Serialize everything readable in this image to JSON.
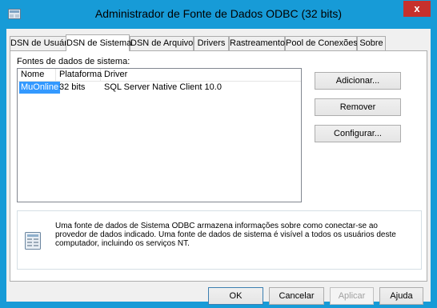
{
  "window": {
    "title": "Administrador de Fonte de Dados ODBC (32 bits)",
    "close_label": "x"
  },
  "tabs": [
    {
      "label": "DSN de Usuário"
    },
    {
      "label": "DSN de Sistema",
      "active": true
    },
    {
      "label": "DSN de Arquivo"
    },
    {
      "label": "Drivers"
    },
    {
      "label": "Rastreamento"
    },
    {
      "label": "Pool de Conexões"
    },
    {
      "label": "Sobre"
    }
  ],
  "section_label": "Fontes de dados de sistema:",
  "list": {
    "columns": [
      "Nome",
      "Plataforma",
      "Driver"
    ],
    "rows": [
      {
        "name": "MuOnline",
        "platform": "32 bits",
        "driver": "SQL Server Native Client 10.0",
        "selected": true
      }
    ]
  },
  "side_buttons": {
    "add": "Adicionar...",
    "remove": "Remover",
    "configure": "Configurar..."
  },
  "info": {
    "icon": "database-info-icon",
    "text": "Uma fonte de dados de Sistema ODBC armazena informações sobre como conectar-se ao provedor de dados indicado. Uma fonte de dados de sistema é visível a todos os usuários deste computador, incluindo os serviços NT."
  },
  "footer_buttons": {
    "ok": "OK",
    "cancel": "Cancelar",
    "apply": "Aplicar",
    "help": "Ajuda"
  },
  "colors": {
    "title_bar": "#179bd7",
    "close": "#c7302c",
    "selection": "#3399ff"
  }
}
